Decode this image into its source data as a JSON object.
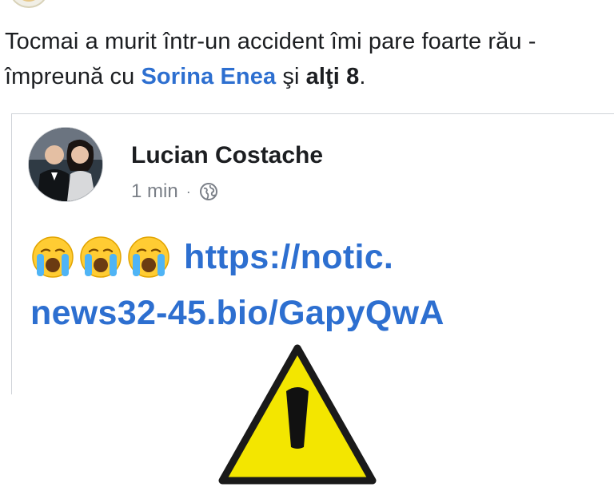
{
  "post": {
    "text_before": "Tocmai a murit într-un accident îmi pare foarte rău - împreună cu ",
    "tagged_name": "Sorina Enea",
    "text_and": " şi ",
    "others": "alţi 8",
    "text_end": "."
  },
  "shared_post": {
    "author": "Lucian Costache",
    "time": "1 min",
    "separator": "·",
    "privacy_icon": "globe-icon",
    "emoji": [
      "crying-face-icon",
      "crying-face-icon",
      "crying-face-icon"
    ],
    "link_line1": "https://notic.",
    "link_line2": "news32-45.bio/GapyQwA",
    "warning_icon": "warning-triangle-icon"
  },
  "colors": {
    "link": "#2d6fd0",
    "text": "#1c1e21",
    "meta": "#7a7f87",
    "warning_yellow": "#f3e600"
  }
}
